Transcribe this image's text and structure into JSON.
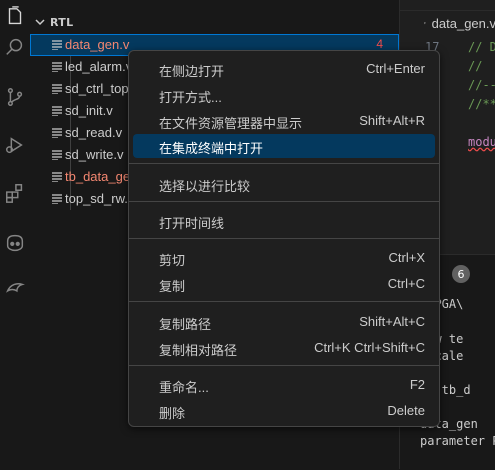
{
  "explorer": {
    "section_title": "RTL",
    "files": [
      {
        "name": "data_gen.v",
        "badge": "4"
      },
      {
        "name": "led_alarm.v"
      },
      {
        "name": "sd_ctrl_top.v"
      },
      {
        "name": "sd_init.v"
      },
      {
        "name": "sd_read.v"
      },
      {
        "name": "sd_write.v"
      },
      {
        "name": "tb_data_gen.v"
      },
      {
        "name": "top_sd_rw.v"
      }
    ]
  },
  "editor": {
    "tab_label": "data_gen.v",
    "lines": [
      {
        "num": "17",
        "text": "// D"
      },
      {
        "num": "18",
        "text": "//"
      },
      {
        "num": "19",
        "text": "//--"
      },
      {
        "num": "20",
        "text": "//**"
      },
      {
        "num": "",
        "text": "modu"
      }
    ]
  },
  "panel": {
    "badge": "6",
    "lines": [
      "\\FPGA\\",
      "New te",
      "escale",
      "le tb_d",
      "data_gen",
      "parameter P"
    ]
  },
  "menu": {
    "items": [
      {
        "label": "在侧边打开",
        "shortcut": "Ctrl+Enter"
      },
      {
        "label": "打开方式...",
        "shortcut": ""
      },
      {
        "label": "在文件资源管理器中显示",
        "shortcut": "Shift+Alt+R"
      },
      {
        "label": "在集成终端中打开",
        "shortcut": ""
      },
      {
        "label": "选择以进行比较",
        "shortcut": ""
      },
      {
        "label": "打开时间线",
        "shortcut": ""
      },
      {
        "label": "剪切",
        "shortcut": "Ctrl+X"
      },
      {
        "label": "复制",
        "shortcut": "Ctrl+C"
      },
      {
        "label": "复制路径",
        "shortcut": "Shift+Alt+C"
      },
      {
        "label": "复制相对路径",
        "shortcut": "Ctrl+K Ctrl+Shift+C"
      },
      {
        "label": "重命名...",
        "shortcut": "F2"
      },
      {
        "label": "删除",
        "shortcut": "Delete"
      }
    ]
  },
  "colors": {
    "accent": "#0078d4",
    "selection": "#04395e",
    "error": "#f48771"
  }
}
